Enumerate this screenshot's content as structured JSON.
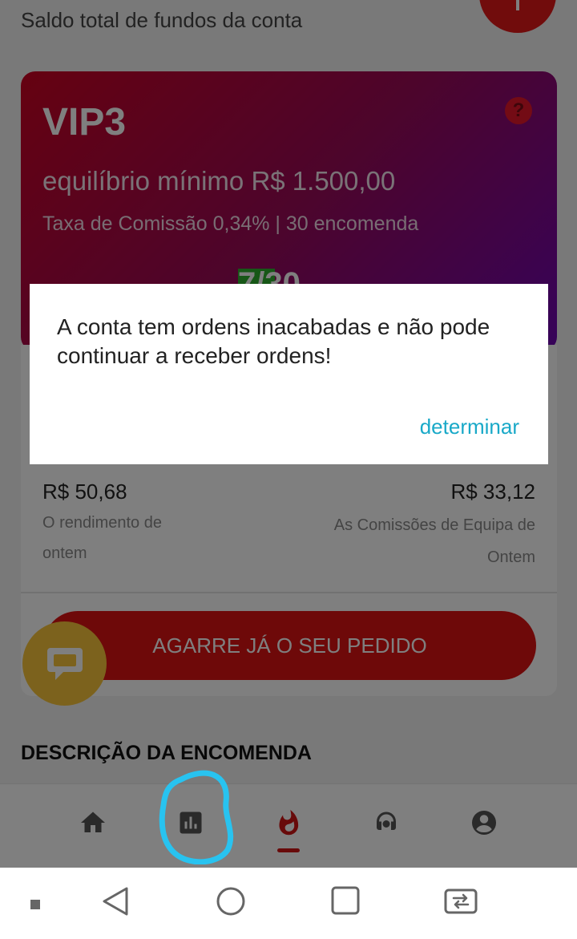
{
  "header": {
    "subtitle": "Saldo total de fundos da conta"
  },
  "vip_card": {
    "title": "VIP3",
    "min_balance": "equilíbrio mínimo R$ 1.500,00",
    "commission": "Taxa de Comissão 0,34% | 30 encomenda",
    "progress_text": "7/30",
    "progress": {
      "current": 7,
      "total": 30
    }
  },
  "stats": {
    "yesterday_income_value": "R$ 50,68",
    "yesterday_income_label": "O rendimento de ontem",
    "team_commission_value": "R$ 33,12",
    "team_commission_label": "As Comissões de Equipa de Ontem"
  },
  "grab_button": "AGARRE JÁ O SEU PEDIDO",
  "section_title": "DESCRIÇÃO DA ENCOMENDA",
  "dialog": {
    "message": "A conta tem ordens inacabadas e não pode continuar a receber ordens!",
    "confirm_label": "determinar"
  },
  "bottom_nav": {
    "items": [
      {
        "icon": "home-icon"
      },
      {
        "icon": "bar-chart-icon"
      },
      {
        "icon": "flame-icon",
        "active": true
      },
      {
        "icon": "support-agent-icon"
      },
      {
        "icon": "account-icon"
      }
    ]
  },
  "colors": {
    "brand": "#dc1313",
    "accent_link": "#19a9c8",
    "chat_fab": "#f9c53a",
    "annotation": "#28c3f0"
  }
}
